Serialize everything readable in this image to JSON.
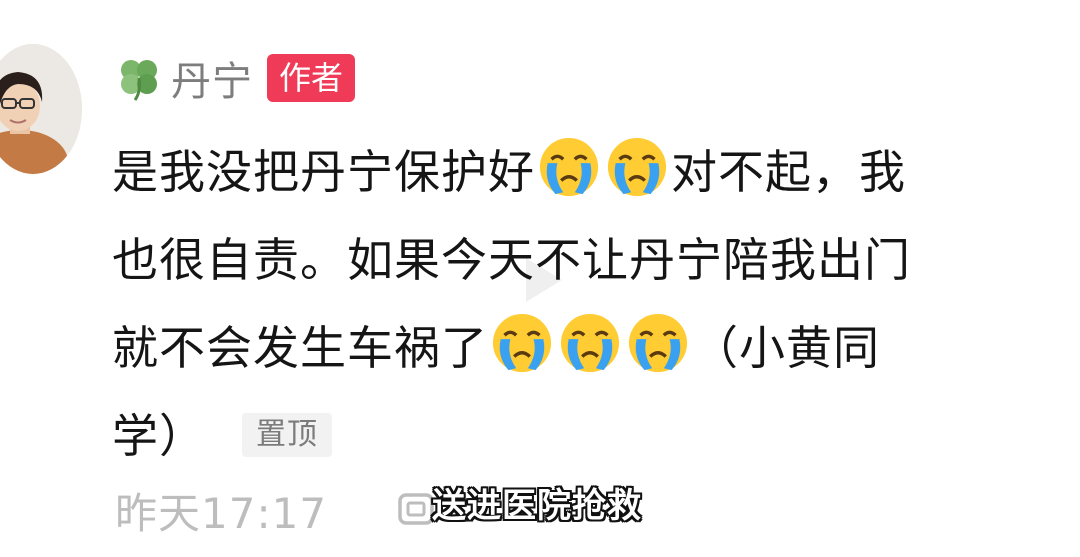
{
  "comment": {
    "author_name": "丹宁",
    "author_badge": "作者",
    "author_icon": "clover-icon",
    "text_line1": "是我没把丹宁保护好",
    "text_after_emoji1": "对不起，我",
    "text_line2": "也很自责。如果今天不让丹宁陪我出门",
    "text_line3": "就不会发生车祸了",
    "text_after_emoji2": "（小黄同",
    "text_line4": "学）",
    "emoji": "loudly-crying-face",
    "pin_label": "置顶",
    "time": "昨天17:17"
  },
  "subtitle": "送进医院抢救",
  "colors": {
    "badge": "#ef3b57",
    "meta": "#bdbdbd",
    "name": "#7d7d7d"
  }
}
